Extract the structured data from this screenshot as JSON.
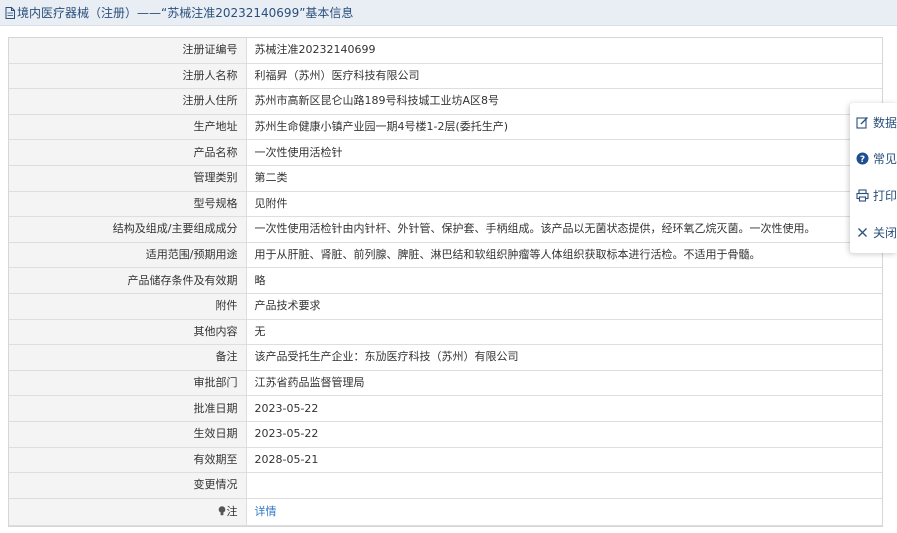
{
  "header": {
    "title": "境内医疗器械（注册）——“苏械注准20232140699”基本信息"
  },
  "details": [
    {
      "label": "注册证编号",
      "value": "苏械注准20232140699"
    },
    {
      "label": "注册人名称",
      "value": "利福昇（苏州）医疗科技有限公司"
    },
    {
      "label": "注册人住所",
      "value": "苏州市高新区昆仑山路189号科技城工业坊A区8号"
    },
    {
      "label": "生产地址",
      "value": "苏州生命健康小镇产业园一期4号楼1-2层(委托生产)"
    },
    {
      "label": "产品名称",
      "value": "一次性使用活检针"
    },
    {
      "label": "管理类别",
      "value": "第二类"
    },
    {
      "label": "型号规格",
      "value": "见附件"
    },
    {
      "label": "结构及组成/主要组成成分",
      "value": "一次性使用活检针由内针杆、外针管、保护套、手柄组成。该产品以无菌状态提供，经环氧乙烷灭菌。一次性使用。"
    },
    {
      "label": "适用范围/预期用途",
      "value": "用于从肝脏、肾脏、前列腺、脾脏、淋巴结和软组织肿瘤等人体组织获取标本进行活检。不适用于骨髓。"
    },
    {
      "label": "产品储存条件及有效期",
      "value": "略"
    },
    {
      "label": "附件",
      "value": "产品技术要求"
    },
    {
      "label": "其他内容",
      "value": "无"
    },
    {
      "label": "备注",
      "value": "该产品受托生产企业：东劢医疗科技（苏州）有限公司"
    },
    {
      "label": "审批部门",
      "value": "江苏省药品监督管理局"
    },
    {
      "label": "批准日期",
      "value": "2023-05-22"
    },
    {
      "label": "生效日期",
      "value": "2023-05-22"
    },
    {
      "label": "有效期至",
      "value": "2028-05-21"
    },
    {
      "label": "变更情况",
      "value": ""
    }
  ],
  "note": {
    "label": "注",
    "link": "详情"
  },
  "side_panel": {
    "items": [
      {
        "label": "数据",
        "icon": "edit-icon"
      },
      {
        "label": "常见",
        "icon": "help-icon"
      },
      {
        "label": "打印",
        "icon": "print-icon"
      },
      {
        "label": "关闭",
        "icon": "close-icon"
      }
    ]
  },
  "colors": {
    "header_bg": "#e9eef4",
    "header_text": "#2a4f7c",
    "label_bg": "#f4f4f4",
    "link": "#2d78c8"
  }
}
